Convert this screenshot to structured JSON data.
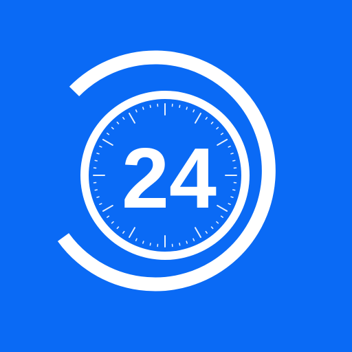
{
  "icon": {
    "label": "24",
    "background_color": "#0A6AF5",
    "foreground_color": "#FFFFFF",
    "glyph": "clock-24-icon"
  }
}
